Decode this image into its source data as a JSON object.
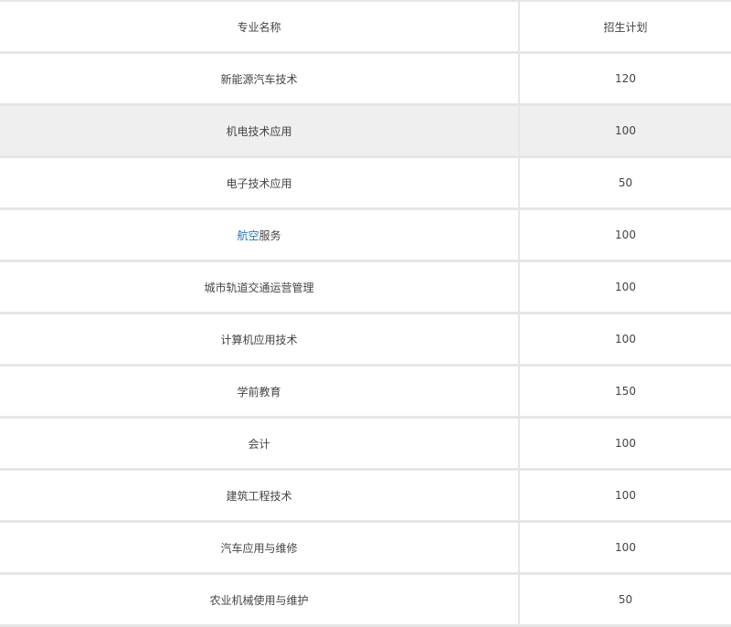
{
  "table": {
    "headers": {
      "major": "专业名称",
      "plan": "招生计划"
    },
    "rows": [
      {
        "major": "新能源汽车技术",
        "plan": "120"
      },
      {
        "major": "机电技术应用",
        "plan": "100"
      },
      {
        "major": "电子技术应用",
        "plan": "50"
      },
      {
        "major_link": "航空",
        "major_rest": "服务",
        "plan": "100"
      },
      {
        "major": "城市轨道交通运营管理",
        "plan": "100"
      },
      {
        "major": "计算机应用技术",
        "plan": "100"
      },
      {
        "major": "学前教育",
        "plan": "150"
      },
      {
        "major": "会计",
        "plan": "100"
      },
      {
        "major": "建筑工程技术",
        "plan": "100"
      },
      {
        "major": "汽车应用与维修",
        "plan": "100"
      },
      {
        "major": "农业机械使用与维护",
        "plan": "50"
      }
    ],
    "highlighted_row": 2
  },
  "colors": {
    "link": "#1e76c4",
    "border": "#e6e6e6",
    "highlight_bg": "#efefef",
    "text": "#444444"
  }
}
